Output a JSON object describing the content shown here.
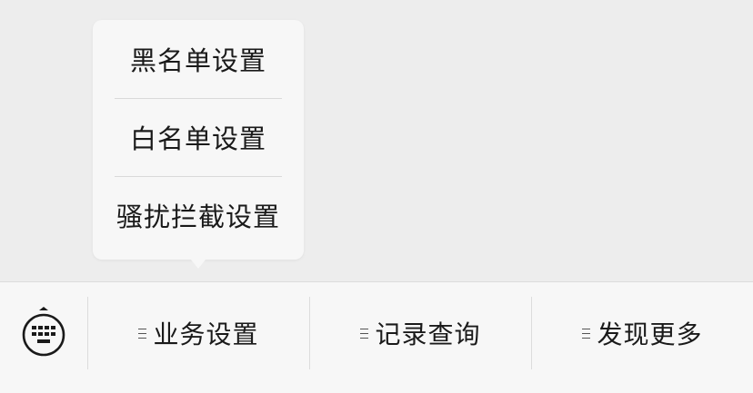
{
  "popup_menu": {
    "items": [
      {
        "label": "黑名单设置"
      },
      {
        "label": "白名单设置"
      },
      {
        "label": "骚扰拦截设置"
      }
    ]
  },
  "bottom_bar": {
    "keyboard_icon": "keyboard-toggle-icon",
    "menus": [
      {
        "label": "业务设置",
        "icon": "menu-lines-icon"
      },
      {
        "label": "记录查询",
        "icon": "menu-lines-icon"
      },
      {
        "label": "发现更多",
        "icon": "menu-lines-icon"
      }
    ]
  },
  "colors": {
    "background": "#ededed",
    "panel": "#f7f7f7",
    "divider": "#d9d9d9",
    "text": "#1a1a1a"
  }
}
